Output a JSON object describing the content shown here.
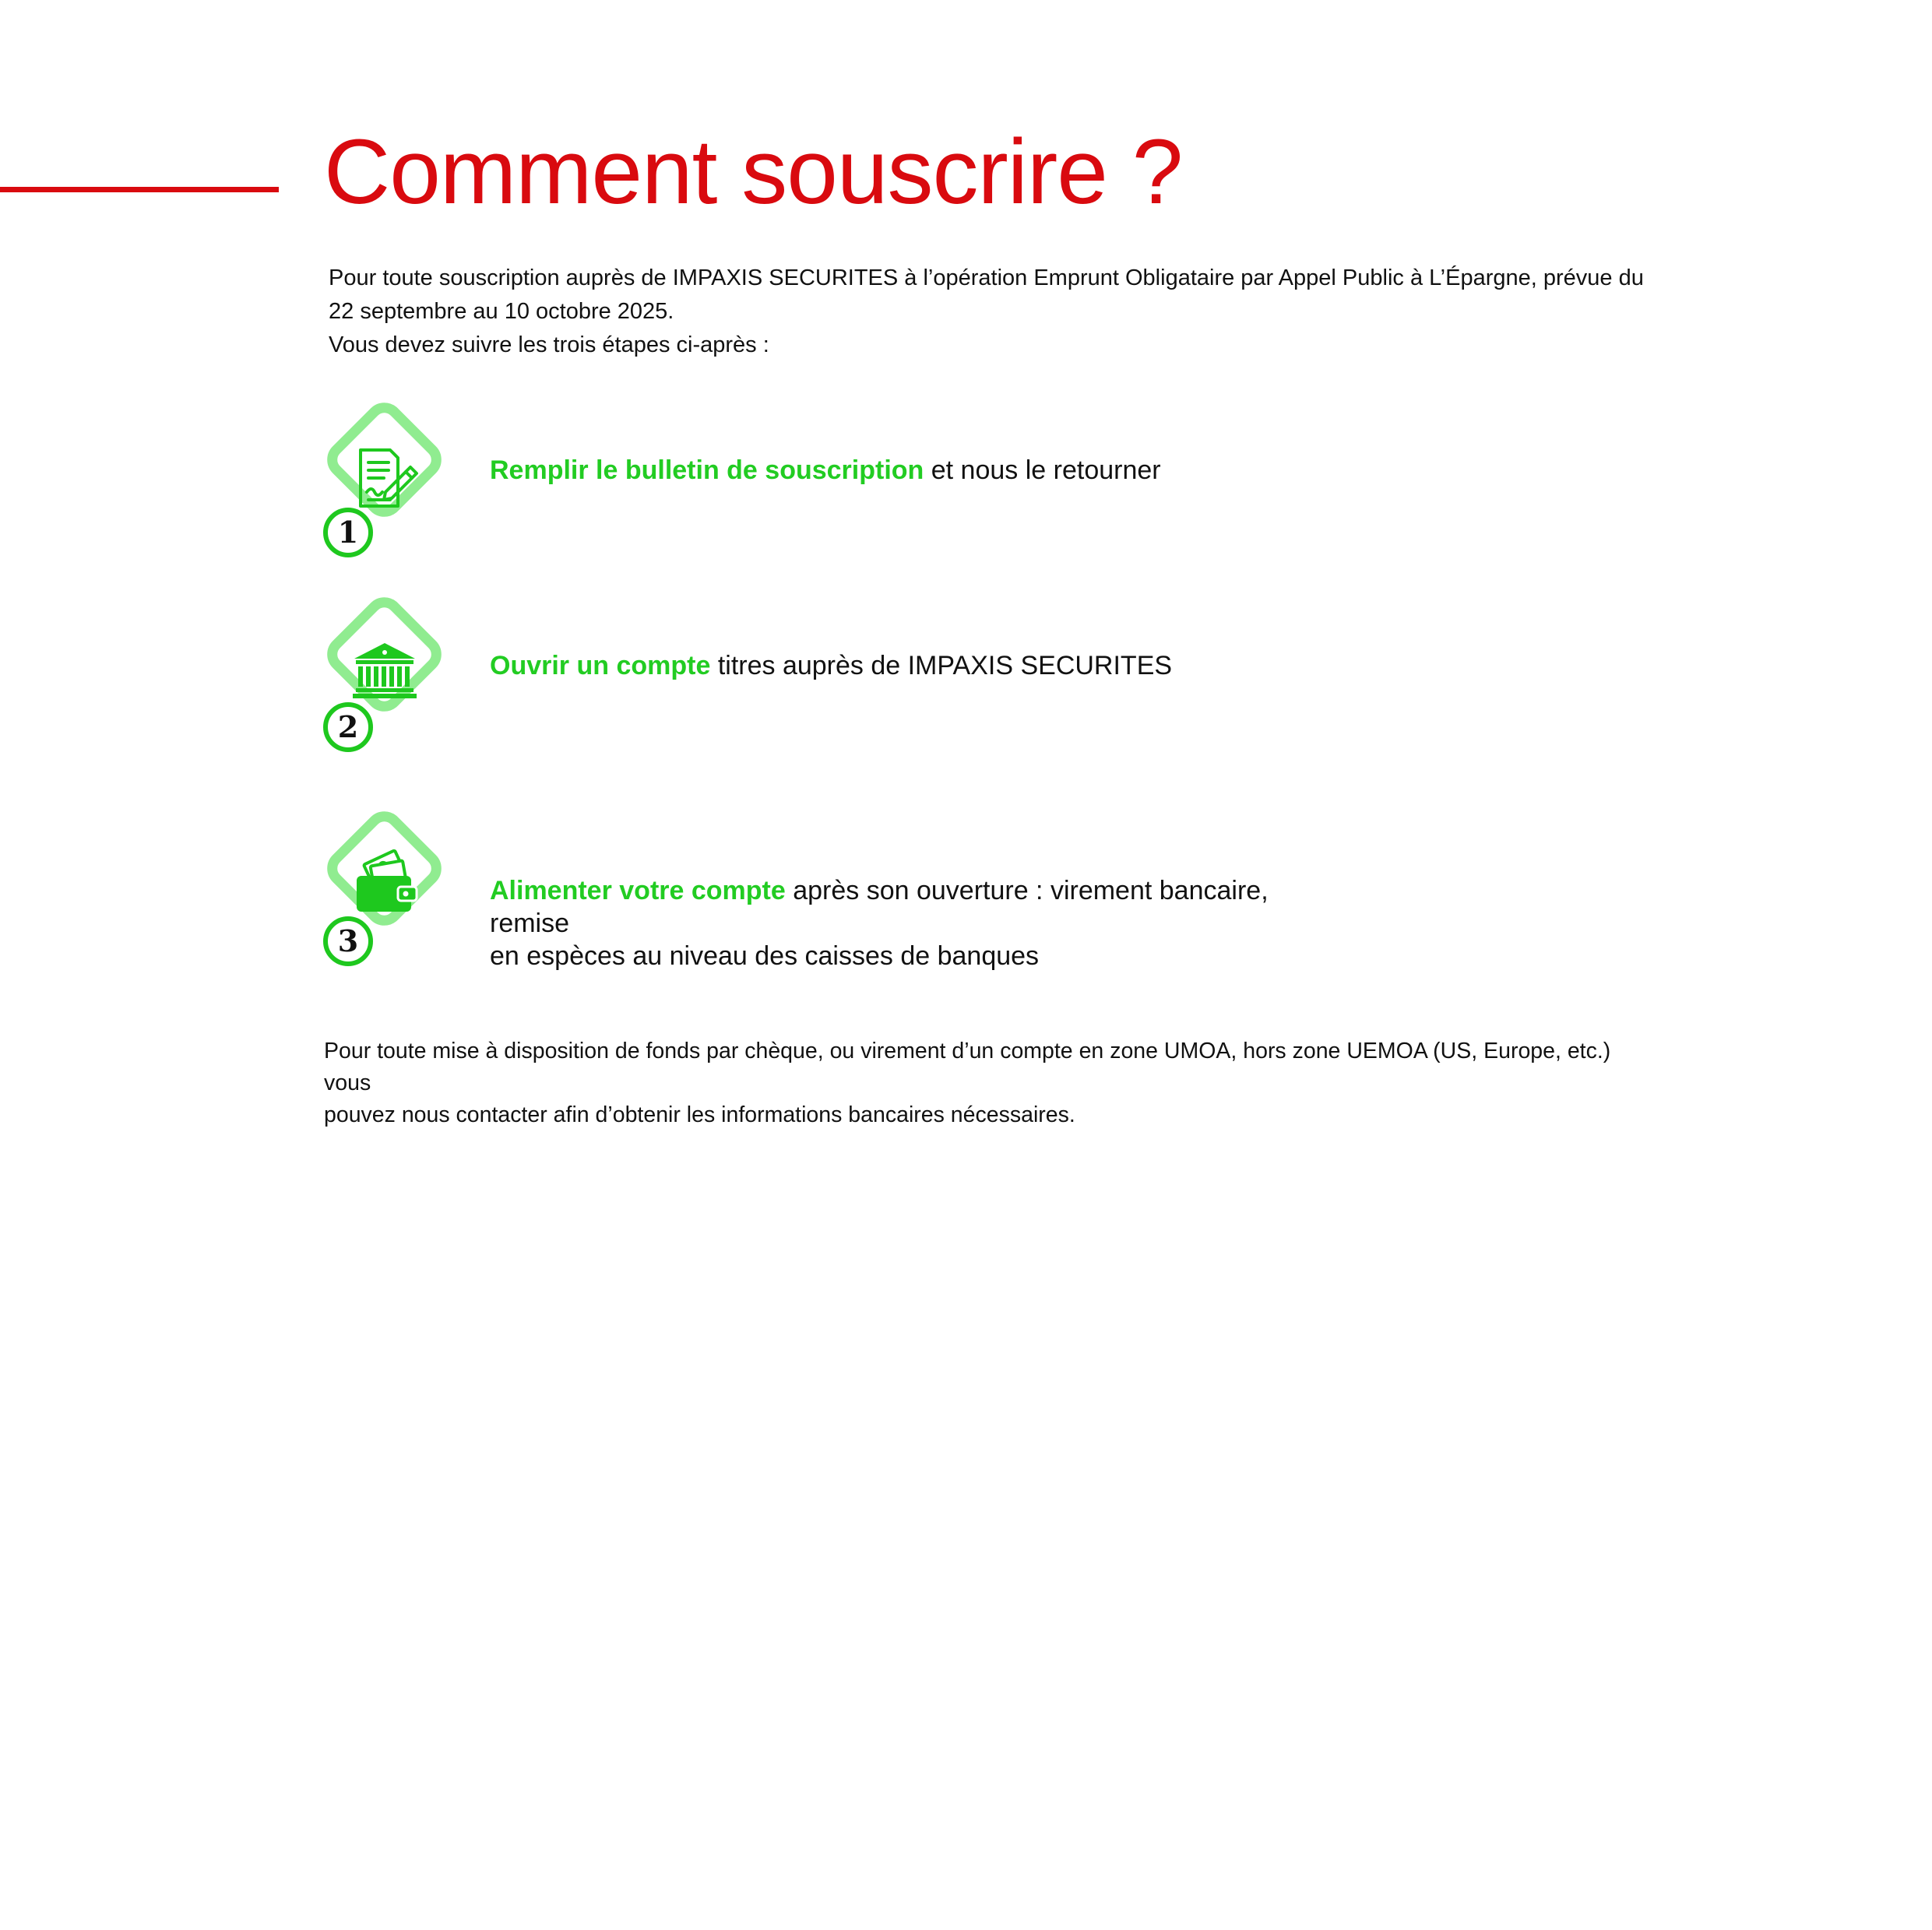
{
  "page": {
    "title": "Comment souscrire ?",
    "intro_lines": [
      "Pour toute souscription auprès de IMPAXIS SECURITES à l’opération Emprunt Obligataire par Appel Public à L’Épargne, prévue du",
      "22 septembre au 10 octobre 2025.",
      "Vous devez suivre les trois étapes ci-après :"
    ]
  },
  "steps": [
    {
      "number": "1",
      "icon": "form-pencil-icon",
      "highlight": "Remplir le bulletin de souscription",
      "rest": " et nous le retourner"
    },
    {
      "number": "2",
      "icon": "bank-icon",
      "highlight": "Ouvrir un compte",
      "rest": " titres auprès de IMPAXIS SECURITES"
    },
    {
      "number": "3",
      "icon": "wallet-money-icon",
      "highlight": "Alimenter votre compte",
      "rest_line1": " après son ouverture : virement bancaire, remise",
      "rest_line2": "en espèces au niveau des caisses de banques"
    }
  ],
  "footer_lines": [
    "Pour toute mise à disposition de fonds par chèque, ou virement d’un compte en zone UMOA, hors zone UEMOA (US, Europe, etc.) vous",
    "pouvez nous contacter afin d’obtenir les informations bancaires nécessaires."
  ],
  "colors": {
    "title_red": "#d90a0f",
    "highlight_green": "#22cc22",
    "icon_green": "#1ec81e",
    "diamond_light_green": "#90ec90"
  }
}
